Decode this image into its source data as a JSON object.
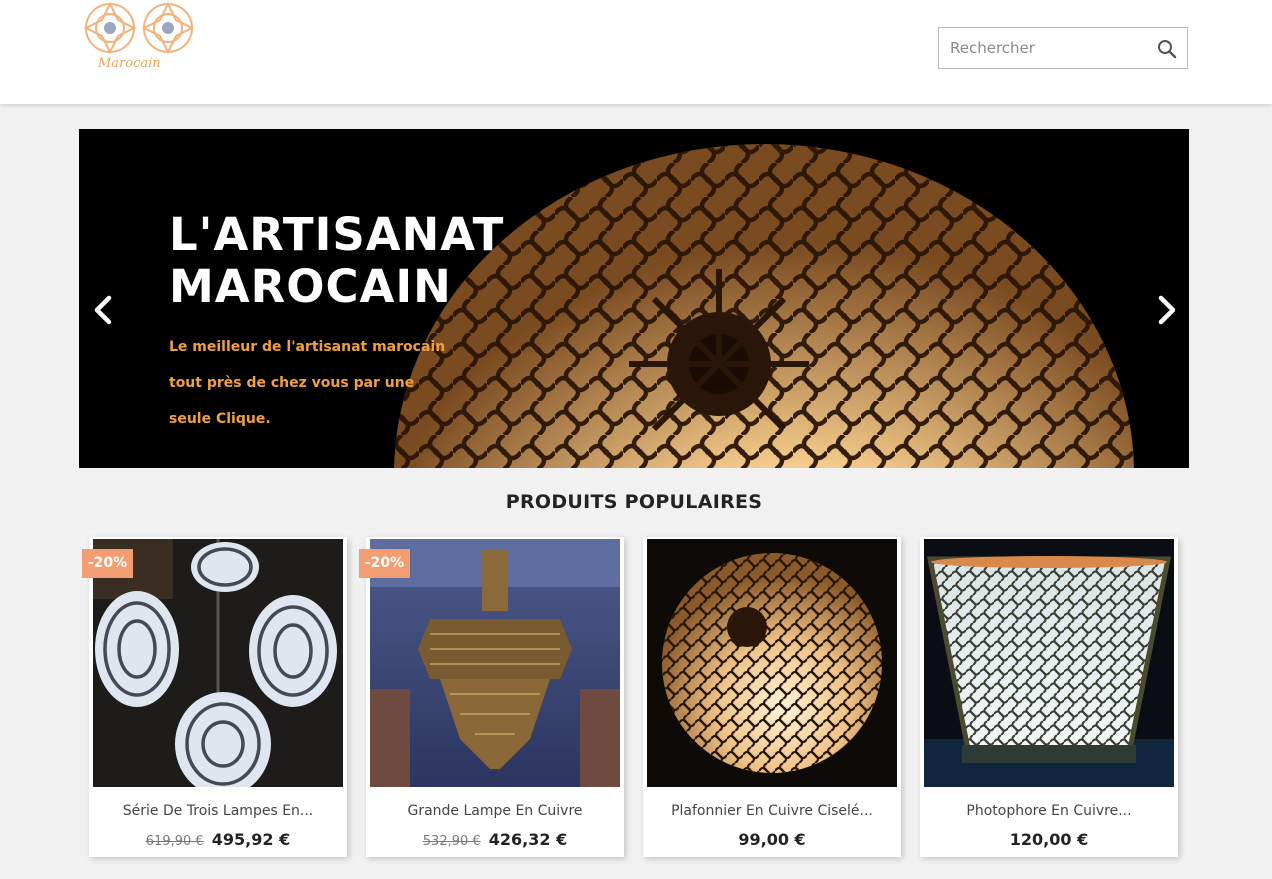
{
  "header": {
    "logo_text": "Marocain",
    "search": {
      "placeholder": "Rechercher",
      "icon": "search-icon"
    }
  },
  "hero": {
    "title_line1": "L'ARTISANAT",
    "title_line2": "MAROCAIN",
    "subtitle_line1": "Le meilleur de l'artisanat marocain",
    "subtitle_line2": "tout près de chez vous par une",
    "subtitle_line3": "seule Clique.",
    "prev_icon": "chevron-left-icon",
    "next_icon": "chevron-right-icon"
  },
  "section": {
    "title": "PRODUITS POPULAIRES"
  },
  "products": [
    {
      "name": "Série De Trois Lampes En...",
      "old_price": "619,90 €",
      "price": "495,92 €",
      "discount": "-20%"
    },
    {
      "name": "Grande Lampe En Cuivre",
      "old_price": "532,90 €",
      "price": "426,32 €",
      "discount": "-20%"
    },
    {
      "name": "Plafonnier En Cuivre Ciselé...",
      "old_price": "",
      "price": "99,00 €",
      "discount": ""
    },
    {
      "name": "Photophore En Cuivre...",
      "old_price": "",
      "price": "120,00 €",
      "discount": ""
    }
  ],
  "colors": {
    "accent": "#f0a040",
    "badge": "#f39d72",
    "background": "#f1f1f1"
  }
}
